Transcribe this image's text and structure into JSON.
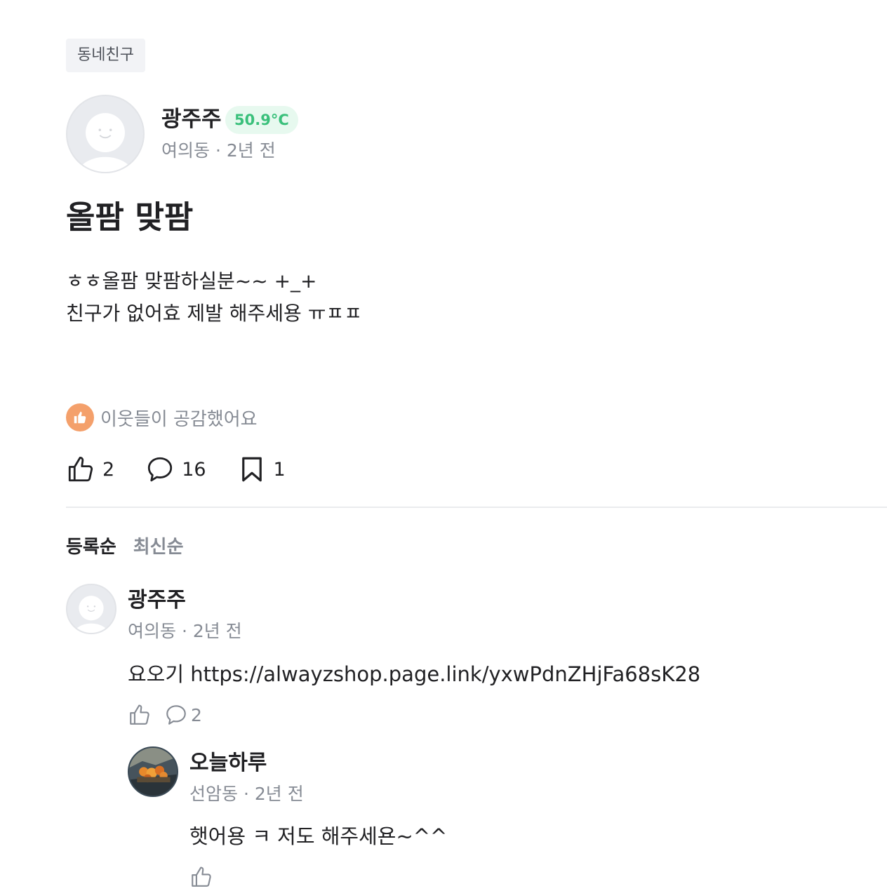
{
  "post": {
    "category": "동네친구",
    "author": {
      "name": "광주주",
      "temperature": "50.9°C",
      "location": "여의동",
      "separator": "·",
      "time": "2년 전",
      "meta": "여의동 · 2년 전"
    },
    "title": "올팜 맞팜",
    "body": "ㅎㅎ올팜 맞팜하실분~~ +_+\n친구가 없어효 제발 해주세용 ㅠㅍㅍ",
    "empathy_text": "이웃들이 공감했어요",
    "counts": {
      "likes": "2",
      "comments": "16",
      "bookmarks": "1"
    }
  },
  "sort": {
    "tabs": [
      "등록순",
      "최신순"
    ],
    "active": "등록순"
  },
  "comments": [
    {
      "author": "광주주",
      "meta": "여의동 · 2년 전",
      "text": "요오기 https://alwayzshop.page.link/yxwPdnZHjFa68sK28",
      "reply_count": "2",
      "replies": [
        {
          "author": "오늘하루",
          "meta": "선암동 · 2년 전",
          "text": "햇어용 ㅋ 저도 해주세욘~^^"
        }
      ]
    }
  ],
  "colors": {
    "temperature_text": "#3ac07b",
    "temperature_bg": "#e7f9ef",
    "empathy_badge": "#f4a06b",
    "muted_text": "#868b94",
    "primary_text": "#212124"
  }
}
